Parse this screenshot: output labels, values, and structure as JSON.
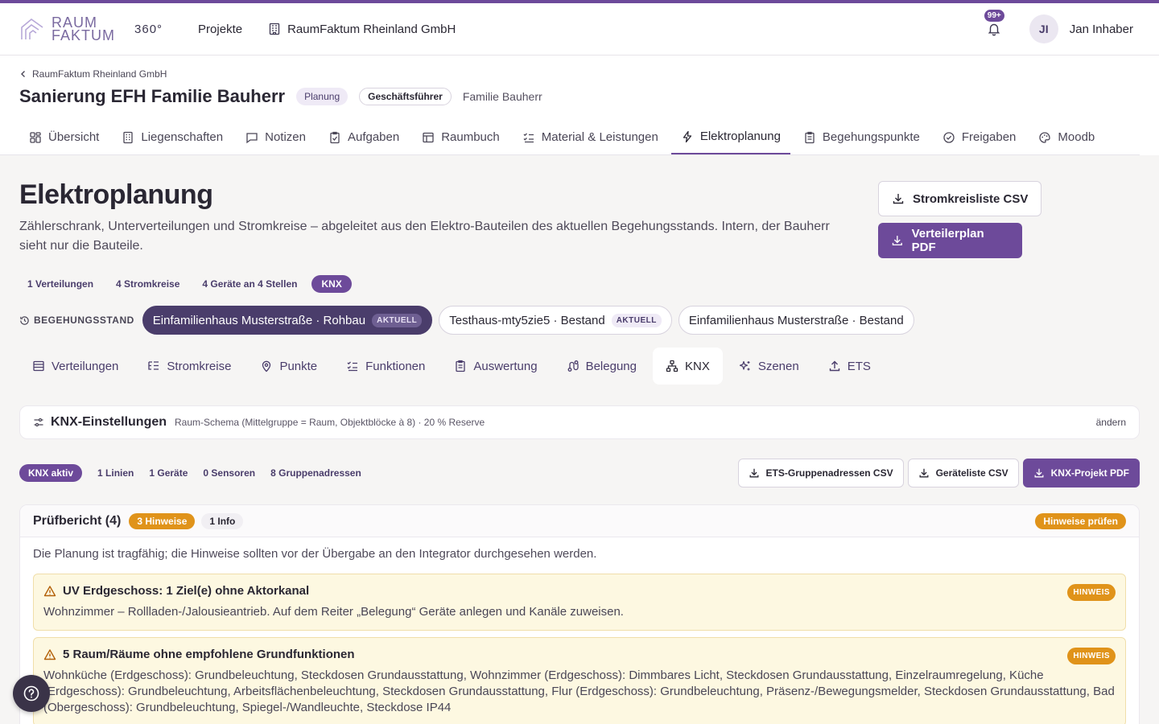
{
  "app": {
    "logo_line1": "RAUM",
    "logo_line2": "FAKTUM",
    "logo_suffix": "360°",
    "nav_projects": "Projekte",
    "nav_company": "RaumFaktum Rheinland GmbH",
    "notifications_badge": "99+",
    "user_initials": "JI",
    "user_name": "Jan Inhaber",
    "accent_color": "#6d4a9a"
  },
  "project": {
    "breadcrumb": "RaumFaktum Rheinland GmbH",
    "title": "Sanierung EFH Familie Bauherr",
    "status_chip": "Planung",
    "role_chip": "Geschäftsführer",
    "client": "Familie Bauherr",
    "tabs": [
      {
        "label": "Übersicht",
        "icon": "grid-icon"
      },
      {
        "label": "Liegenschaften",
        "icon": "building-icon"
      },
      {
        "label": "Notizen",
        "icon": "note-icon"
      },
      {
        "label": "Aufgaben",
        "icon": "clipboard-check-icon"
      },
      {
        "label": "Raumbuch",
        "icon": "table-icon"
      },
      {
        "label": "Material & Leistungen",
        "icon": "list-check-icon"
      },
      {
        "label": "Elektroplanung",
        "icon": "bolt-icon",
        "active": true
      },
      {
        "label": "Begehungspunkte",
        "icon": "clipboard-list-icon"
      },
      {
        "label": "Freigaben",
        "icon": "check-circle-icon"
      },
      {
        "label": "Moodb",
        "icon": "palette-icon"
      }
    ]
  },
  "page": {
    "title": "Elektroplanung",
    "description": "Zählerschrank, Unterverteilungen und Stromkreise – abgeleitet aus den Elektro-Bauteilen des aktuellen Begehungsstands. Intern, der Bauherr sieht nur die Bauteile.",
    "btn_csv": "Stromkreisliste CSV",
    "btn_pdf": "Verteilerplan PDF",
    "stats": [
      "1 Verteilungen",
      "4 Stromkreise",
      "4 Geräte an 4 Stellen"
    ],
    "stat_knx": "KNX",
    "begehung_label": "BEGEHUNGSSTAND",
    "begehungen": [
      {
        "label": "Einfamilienhaus Musterstraße · Rohbau",
        "badge": "AKTUELL",
        "active": true
      },
      {
        "label": "Testhaus-mty5zie5 · Bestand",
        "badge": "AKTUELL",
        "active": false
      },
      {
        "label": "Einfamilienhaus Musterstraße · Bestand",
        "badge": "",
        "active": false
      }
    ],
    "subtabs": [
      {
        "label": "Verteilungen",
        "icon": "table-icon"
      },
      {
        "label": "Stromkreise",
        "icon": "list-tree-icon"
      },
      {
        "label": "Punkte",
        "icon": "map-pin-icon"
      },
      {
        "label": "Funktionen",
        "icon": "list-check-icon"
      },
      {
        "label": "Auswertung",
        "icon": "clipboard-icon"
      },
      {
        "label": "Belegung",
        "icon": "route-icon"
      },
      {
        "label": "KNX",
        "icon": "network-icon",
        "active": true
      },
      {
        "label": "Szenen",
        "icon": "sparkles-icon"
      },
      {
        "label": "ETS",
        "icon": "upload-icon"
      }
    ]
  },
  "knx": {
    "settings_title": "KNX-Einstellungen",
    "settings_desc": "Raum-Schema (Mittelgruppe = Raum, Objektblöcke à 8) · 20 % Reserve",
    "settings_edit": "ändern",
    "active_label": "KNX aktiv",
    "stats": [
      "1 Linien",
      "1 Geräte",
      "0 Sensoren",
      "8 Gruppenadressen"
    ],
    "btn_ets": "ETS-Gruppenadressen CSV",
    "btn_devices": "Geräteliste CSV",
    "btn_pdf": "KNX-Projekt PDF"
  },
  "report": {
    "title": "Prüfbericht (4)",
    "badge_hints": "3 Hinweise",
    "badge_info": "1 Info",
    "check_label": "Hinweise prüfen",
    "summary": "Die Planung ist tragfähig; die Hinweise sollten vor der Übergabe an den Integrator durchgesehen werden.",
    "findings": [
      {
        "title": "UV Erdgeschoss: 1 Ziel(e) ohne Aktorkanal",
        "text": "Wohnzimmer – Rollladen-/Jalousieantrieb. Auf dem Reiter „Belegung“ Geräte anlegen und Kanäle zuweisen.",
        "badge": "HINWEIS"
      },
      {
        "title": "5 Raum/Räume ohne empfohlene Grundfunktionen",
        "text": "Wohnküche (Erdgeschoss): Grundbeleuchtung, Steckdosen Grundausstattung, Wohnzimmer (Erdgeschoss): Dimmbares Licht, Steckdosen Grundausstattung, Einzelraumregelung, Küche (Erdgeschoss): Grundbeleuchtung, Arbeitsflächenbeleuchtung, Steckdosen Grundausstattung, Flur (Erdgeschoss): Grundbeleuchtung, Präsenz-/Bewegungsmelder, Steckdosen Grundausstattung, Bad (Obergeschoss): Grundbeleuchtung, Spiegel-/Wandleuchte, Steckdose IP44",
        "badge": "HINWEIS"
      }
    ]
  }
}
